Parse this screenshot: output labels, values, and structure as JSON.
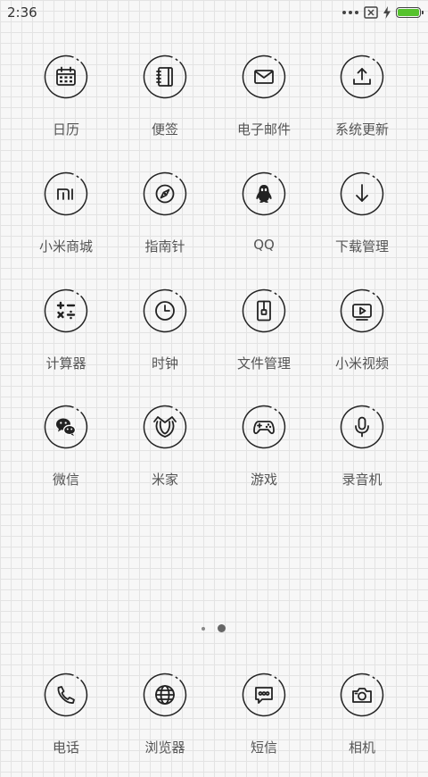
{
  "status_bar": {
    "time": "2:36",
    "battery_level": 1.0,
    "battery_color": "#55c22d"
  },
  "apps": [
    {
      "label": "日历",
      "icon": "calendar-icon"
    },
    {
      "label": "便签",
      "icon": "notes-icon"
    },
    {
      "label": "电子邮件",
      "icon": "mail-icon"
    },
    {
      "label": "系统更新",
      "icon": "upload-icon"
    },
    {
      "label": "小米商城",
      "icon": "mi-icon"
    },
    {
      "label": "指南针",
      "icon": "compass-icon"
    },
    {
      "label": "QQ",
      "icon": "qq-penguin-icon"
    },
    {
      "label": "下载管理",
      "icon": "download-arrow-icon"
    },
    {
      "label": "计算器",
      "icon": "calculator-icon"
    },
    {
      "label": "时钟",
      "icon": "clock-icon"
    },
    {
      "label": "文件管理",
      "icon": "file-icon"
    },
    {
      "label": "小米视频",
      "icon": "video-play-icon"
    },
    {
      "label": "微信",
      "icon": "wechat-icon"
    },
    {
      "label": "米家",
      "icon": "mijia-icon"
    },
    {
      "label": "游戏",
      "icon": "gamepad-icon"
    },
    {
      "label": "录音机",
      "icon": "microphone-icon"
    }
  ],
  "pager": {
    "total_pages": 2,
    "current_page": 2
  },
  "dock": [
    {
      "label": "电话",
      "icon": "phone-icon"
    },
    {
      "label": "浏览器",
      "icon": "globe-icon"
    },
    {
      "label": "短信",
      "icon": "message-icon"
    },
    {
      "label": "相机",
      "icon": "camera-icon"
    }
  ]
}
